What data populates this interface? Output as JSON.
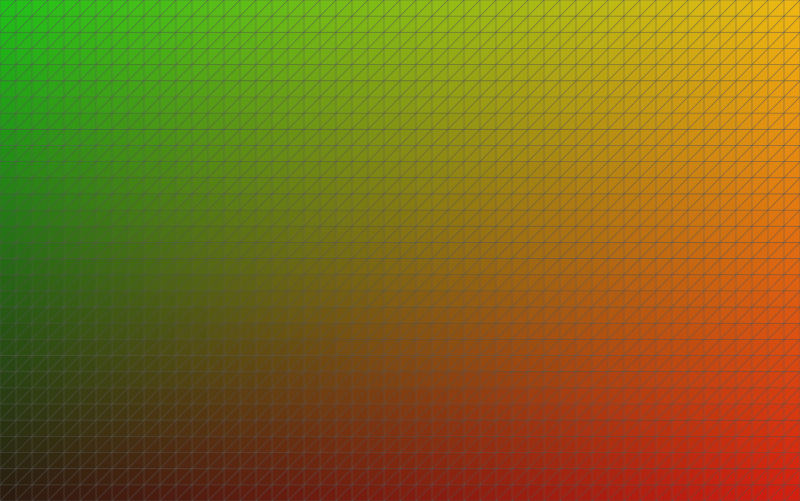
{
  "scene": {
    "type": "gradient-triangle-mesh",
    "corner_colors": {
      "top_left": "#1fc21a",
      "top_right": "#f0b812",
      "bottom_left": "#2a1a10",
      "bottom_right": "#d21d10"
    },
    "grid": {
      "columns": 50,
      "rows": 31,
      "diagonal": "bottom-left-to-top-right",
      "line_color": "#5a5a5a",
      "line_opacity": 0.55
    }
  }
}
